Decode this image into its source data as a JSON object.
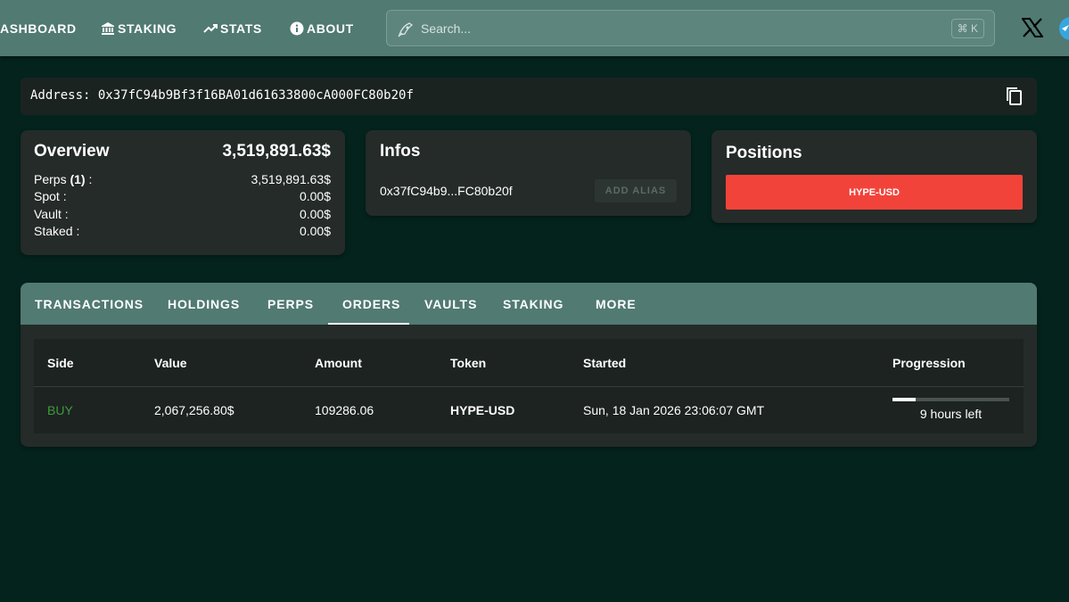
{
  "nav": {
    "items": [
      {
        "label": "ASHBOARD",
        "icon": "dashboard-icon"
      },
      {
        "label": "STAKING",
        "icon": "bank-icon"
      },
      {
        "label": "STATS",
        "icon": "trending-up-icon"
      },
      {
        "label": "ABOUT",
        "icon": "info-icon"
      }
    ],
    "search_placeholder": "Search...",
    "search_shortcut": "⌘ K",
    "social": [
      "x-icon",
      "telegram-icon"
    ]
  },
  "address": {
    "label": "Address:",
    "value": "0x37fC94b9Bf3f16BA01d61633800cA000FC80b20f"
  },
  "overview": {
    "title": "Overview",
    "total": "3,519,891.63$",
    "rows": [
      {
        "label": "Perps",
        "count": "(1)",
        "suffix": " :",
        "value": "3,519,891.63$"
      },
      {
        "label": "Spot :",
        "value": "0.00$"
      },
      {
        "label": "Vault :",
        "value": "0.00$"
      },
      {
        "label": "Staked :",
        "value": "0.00$"
      }
    ]
  },
  "infos": {
    "title": "Infos",
    "short_address": "0x37fC94b9...FC80b20f",
    "alias_button": "ADD ALIAS"
  },
  "positions": {
    "title": "Positions",
    "items": [
      {
        "label": "HYPE-USD",
        "color": "#f2433a"
      }
    ]
  },
  "tabs": {
    "items": [
      "TRANSACTIONS",
      "HOLDINGS",
      "PERPS",
      "ORDERS",
      "VAULTS",
      "STAKING",
      "MORE"
    ],
    "active": "ORDERS"
  },
  "orders": {
    "columns": [
      "Side",
      "Value",
      "Amount",
      "Token",
      "Started",
      "Progression"
    ],
    "rows": [
      {
        "side": "BUY",
        "value": "2,067,256.80$",
        "amount": "109286.06",
        "token": "HYPE-USD",
        "started": "Sun, 18 Jan 2026 23:06:07 GMT",
        "progress_fraction": 0.2,
        "progress_text": "9 hours left"
      }
    ]
  },
  "colors": {
    "background": "#04231d",
    "nav": "#507a72",
    "card": "#242b29",
    "buy": "#3f9a3c",
    "sell_position": "#f2433a"
  }
}
